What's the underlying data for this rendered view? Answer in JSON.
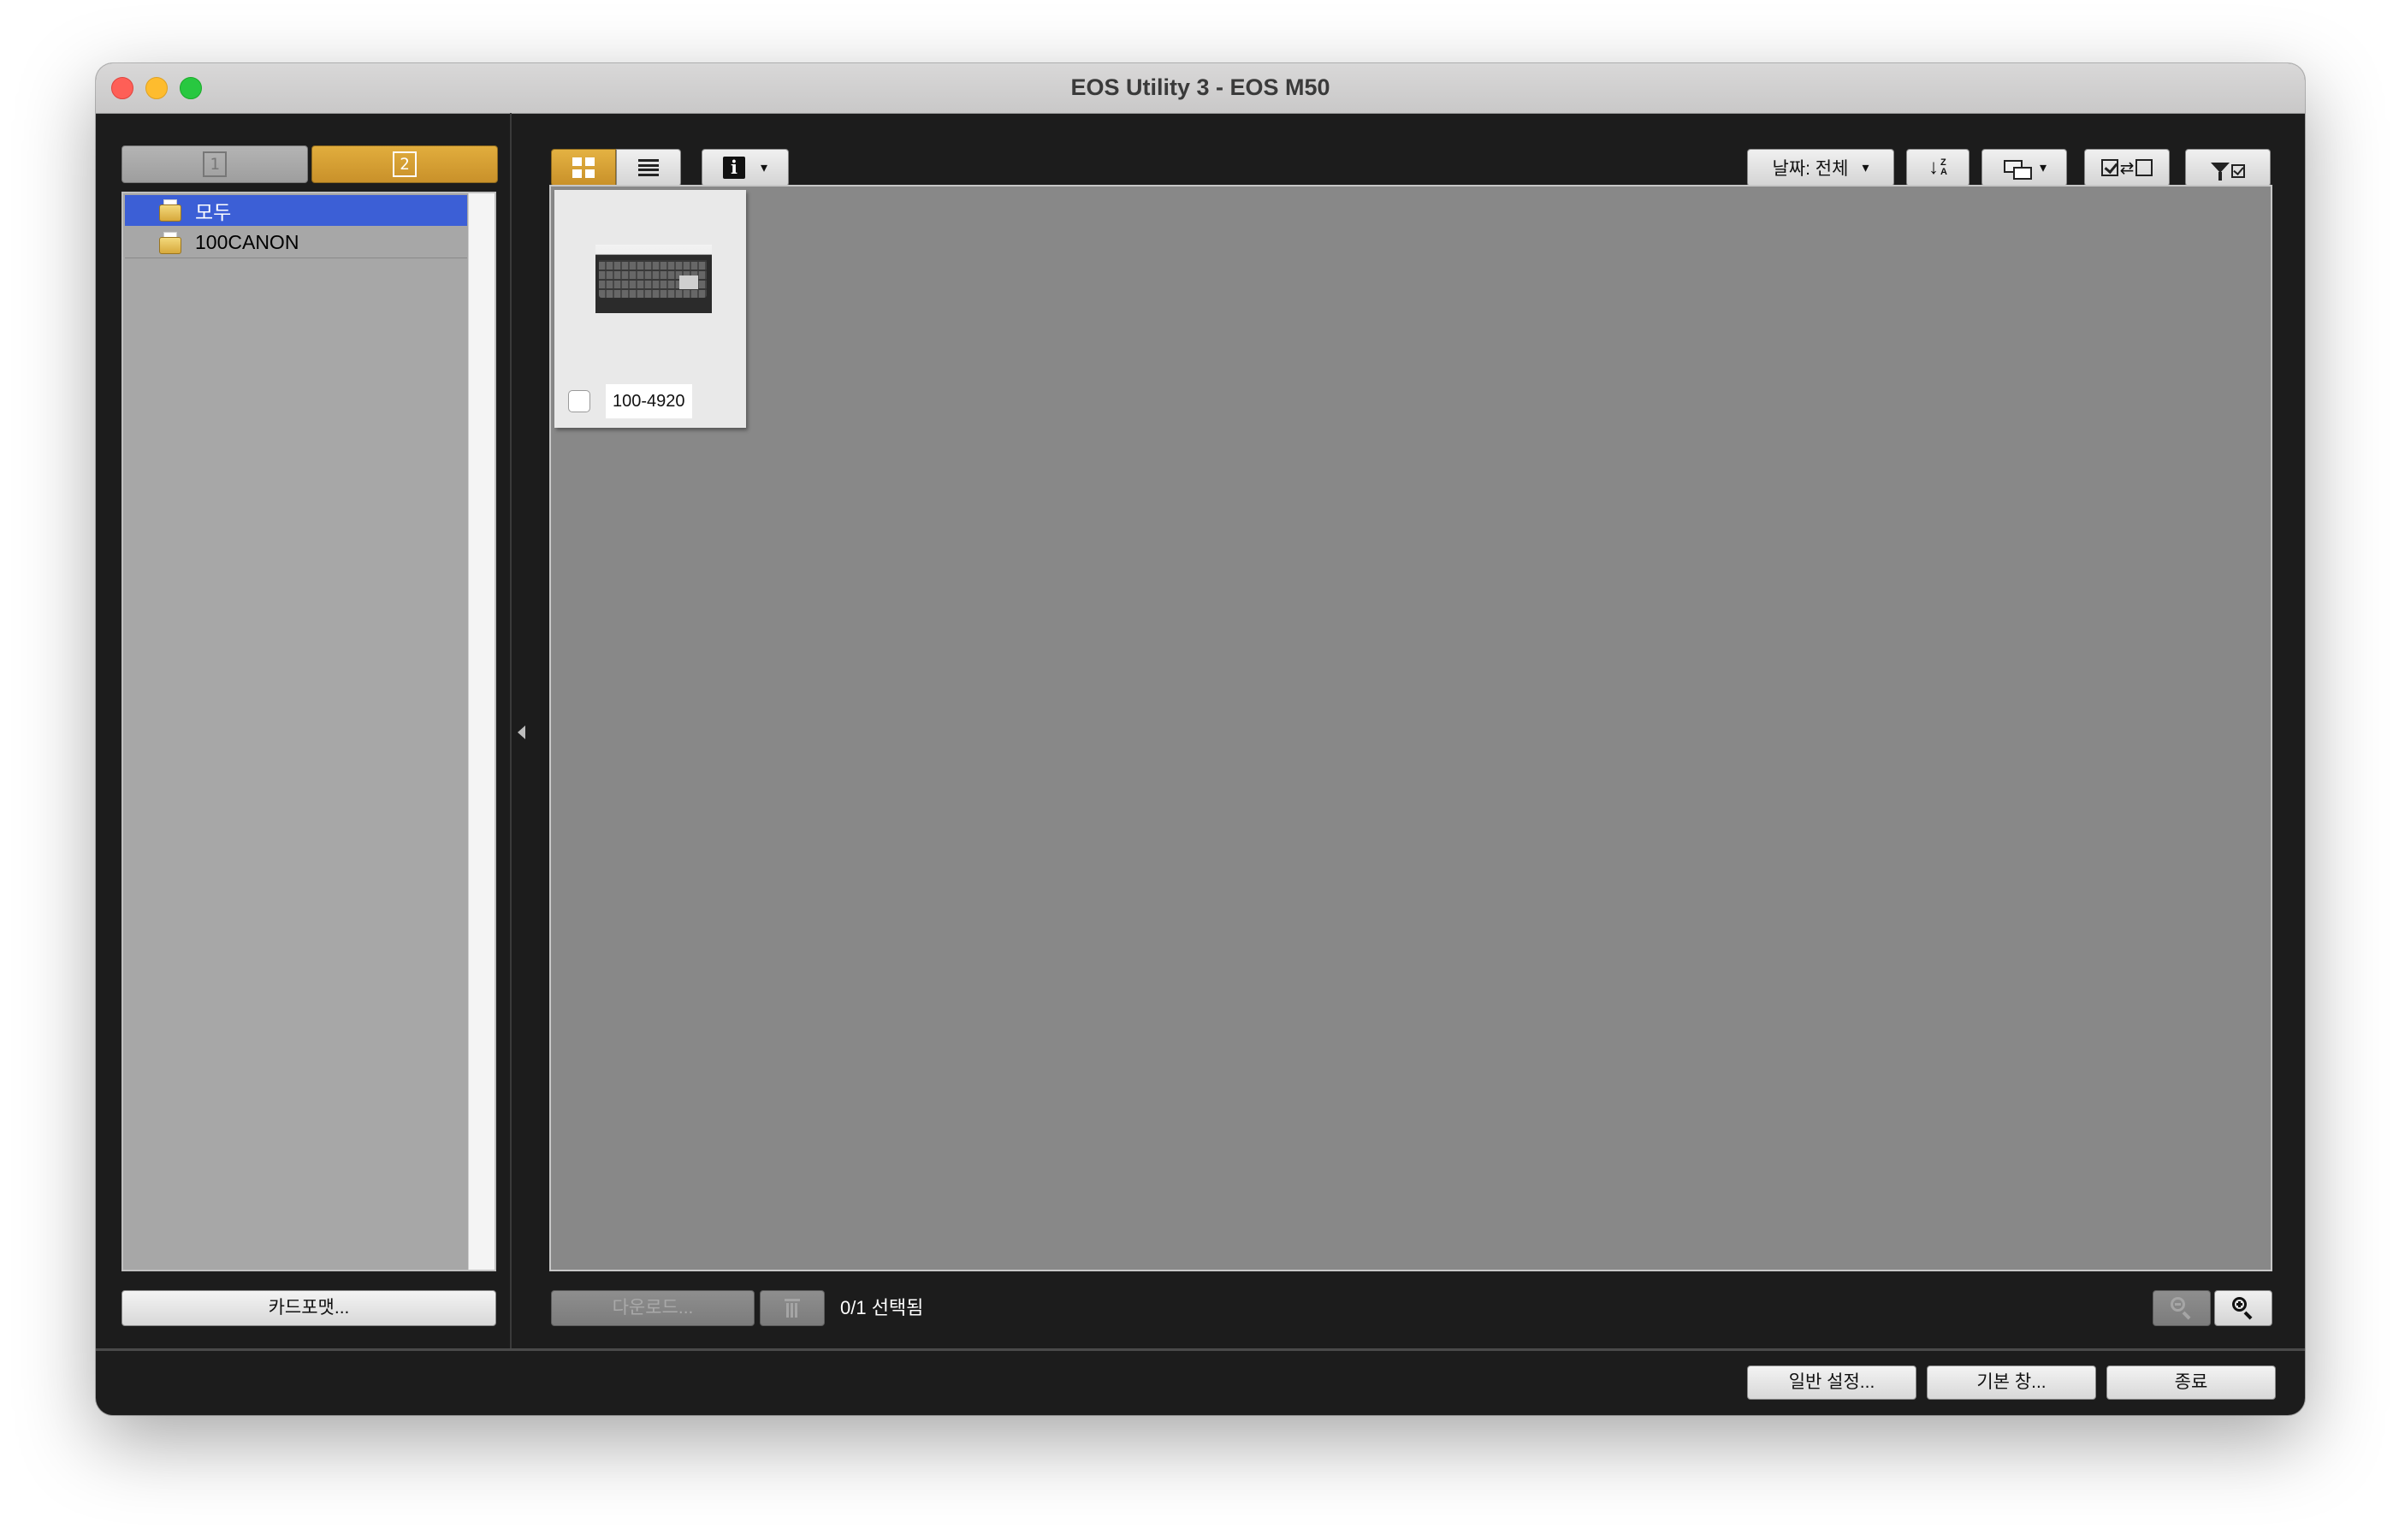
{
  "window": {
    "title": "EOS Utility 3 - EOS M50"
  },
  "sidebar": {
    "card_tabs": [
      {
        "label": "1",
        "active": false
      },
      {
        "label": "2",
        "active": true
      }
    ],
    "folders": [
      {
        "label": "모두",
        "selected": true
      },
      {
        "label": "100CANON",
        "selected": false
      }
    ],
    "card_format_label": "카드포맷..."
  },
  "toolbar": {
    "date_filter_label": "날짜: 전체",
    "dropdown_caret": "▾",
    "swap_glyph": "⇄"
  },
  "content": {
    "thumbnails": [
      {
        "name": "100-4920",
        "checked": false
      }
    ]
  },
  "actions": {
    "download_label": "다운로드...",
    "selection_count": "0/1 선택됨"
  },
  "footer": {
    "preferences_label": "일반 설정...",
    "main_window_label": "기본 창...",
    "quit_label": "종료"
  },
  "colors": {
    "accent_gold": "#d6a136",
    "selection_blue": "#3c5fd6",
    "content_bg": "#888888",
    "chrome_bg": "#1c1c1c"
  }
}
